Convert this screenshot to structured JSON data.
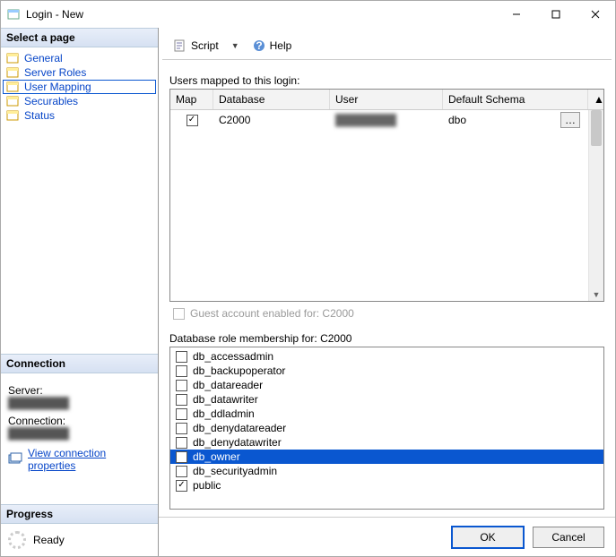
{
  "window": {
    "title": "Login - New"
  },
  "sidebar": {
    "header": "Select a page",
    "pages": [
      {
        "label": "General"
      },
      {
        "label": "Server Roles"
      },
      {
        "label": "User Mapping"
      },
      {
        "label": "Securables"
      },
      {
        "label": "Status"
      }
    ],
    "selected": 2
  },
  "connection": {
    "header": "Connection",
    "server_label": "Server:",
    "server_value": "████████",
    "connection_label": "Connection:",
    "connection_value": "████████",
    "view_link": "View connection properties"
  },
  "progress": {
    "header": "Progress",
    "status": "Ready"
  },
  "toolbar": {
    "script": "Script",
    "help": "Help"
  },
  "mapping": {
    "label": "Users mapped to this login:",
    "columns": [
      "Map",
      "Database",
      "User",
      "Default Schema"
    ],
    "rows": [
      {
        "checked": true,
        "database": "C2000",
        "user": "████████",
        "schema": "dbo"
      }
    ],
    "guest_label": "Guest account enabled for: C2000"
  },
  "roles": {
    "label": "Database role membership for: C2000",
    "items": [
      {
        "name": "db_accessadmin",
        "checked": false
      },
      {
        "name": "db_backupoperator",
        "checked": false
      },
      {
        "name": "db_datareader",
        "checked": false
      },
      {
        "name": "db_datawriter",
        "checked": false
      },
      {
        "name": "db_ddladmin",
        "checked": false
      },
      {
        "name": "db_denydatareader",
        "checked": false
      },
      {
        "name": "db_denydatawriter",
        "checked": false
      },
      {
        "name": "db_owner",
        "checked": true,
        "selected": true
      },
      {
        "name": "db_securityadmin",
        "checked": false
      },
      {
        "name": "public",
        "checked": true
      }
    ]
  },
  "footer": {
    "ok": "OK",
    "cancel": "Cancel"
  }
}
